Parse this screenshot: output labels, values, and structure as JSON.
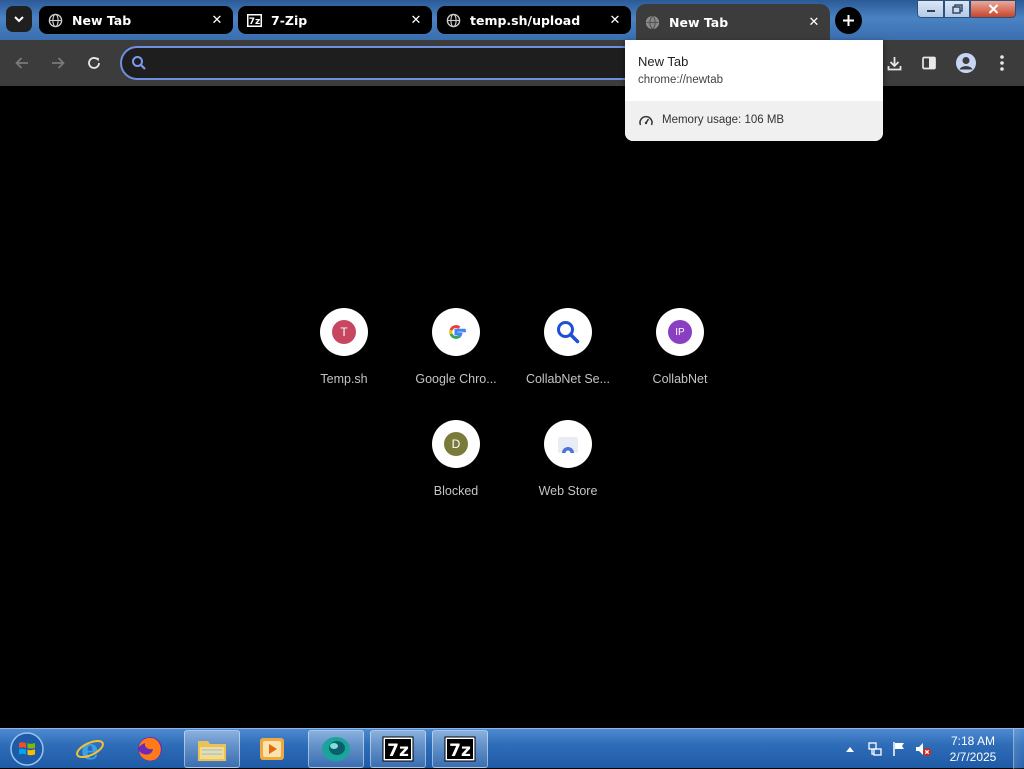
{
  "tabs": [
    {
      "label": "New Tab",
      "icon": "globe-icon",
      "active": false
    },
    {
      "label": "7-Zip",
      "icon": "sevenzip-icon",
      "active": false
    },
    {
      "label": "temp.sh/upload",
      "icon": "globe-icon",
      "active": false
    },
    {
      "label": "New Tab",
      "icon": "globe-icon",
      "active": true
    }
  ],
  "omnibox": {
    "value": "",
    "placeholder": ""
  },
  "hover_card": {
    "title": "New Tab",
    "url": "chrome://newtab",
    "memory": "Memory usage: 106 MB"
  },
  "shortcuts": [
    {
      "name": "Temp.sh",
      "letter": "T",
      "color": "#c6475f"
    },
    {
      "name": "Google Chro...",
      "icon": "google-icon"
    },
    {
      "name": "CollabNet Se...",
      "icon": "magnifier-icon"
    },
    {
      "name": "CollabNet",
      "letter": "IP",
      "color": "#8a3fc2"
    },
    {
      "name": "Blocked",
      "letter": "D",
      "color": "#7a7a3a"
    },
    {
      "name": "Web Store",
      "icon": "webstore-icon"
    }
  ],
  "taskbar": {
    "apps": [
      "internet-explorer-icon",
      "firefox-icon",
      "file-explorer-icon",
      "media-player-icon",
      "chrome-icon",
      "sevenzip-icon",
      "sevenzip-icon"
    ]
  },
  "clock": {
    "time": "7:18 AM",
    "date": "2/7/2025"
  }
}
